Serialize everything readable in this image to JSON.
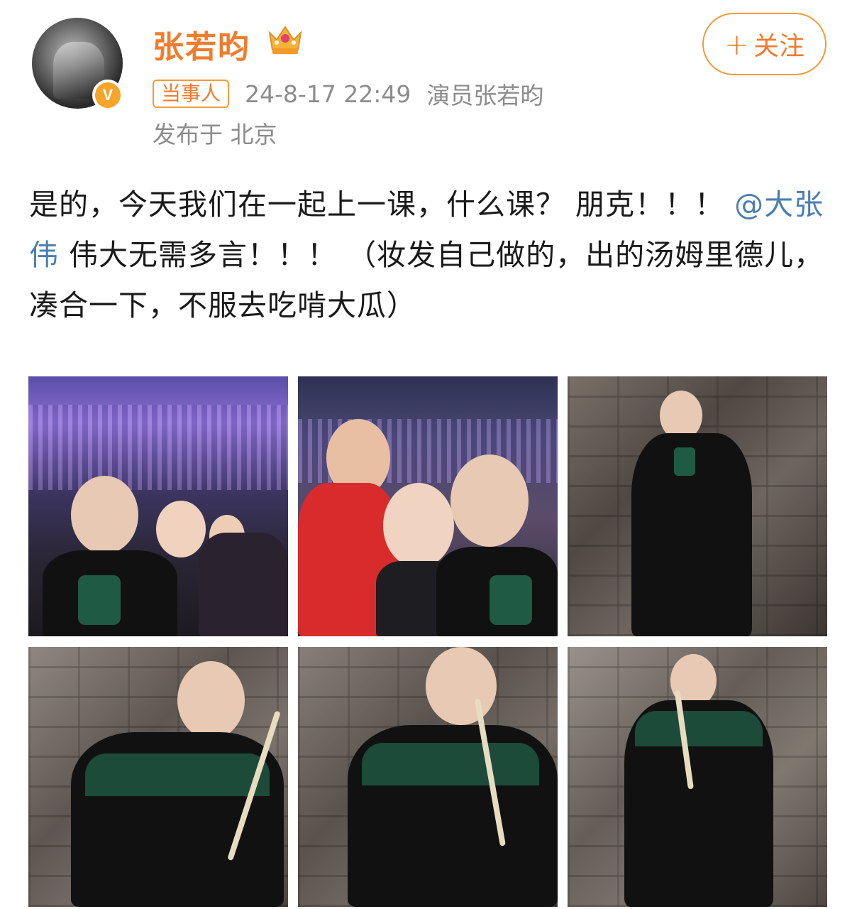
{
  "user": {
    "name": "张若昀",
    "verified_badge": "V",
    "tag": "当事人",
    "time": "24-8-17 22:49",
    "source": "演员张若昀",
    "location": "发布于 北京"
  },
  "follow": {
    "plus": "+",
    "label": "关注"
  },
  "post": {
    "text_before": "是的，今天我们在一起上一课，什么课？ 朋克！！！ ",
    "mention": "@大张伟",
    "text_after": " 伟大无需多言！！！ （妆发自己做的，出的汤姆里德儿，凑合一下，不服去吃啃大瓜）"
  },
  "icons": {
    "crown": "crown-icon",
    "verified": "verified-icon"
  },
  "colors": {
    "accent": "#f07c2d",
    "mention": "#4a7fb0",
    "meta": "#8c8c8c"
  }
}
